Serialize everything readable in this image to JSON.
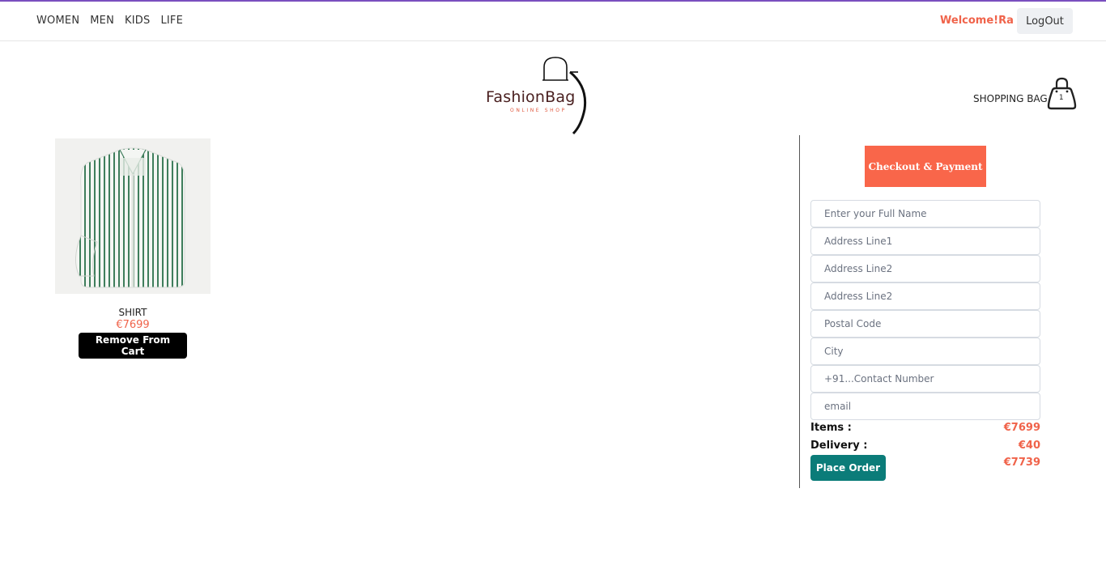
{
  "nav": {
    "links": [
      "WOMEN",
      "MEN",
      "KIDS",
      "LIFE"
    ],
    "welcome": "Welcome!Ra",
    "logout": "LogOut"
  },
  "logo": {
    "name": "FashionBag",
    "tagline": "ONLINE SHOP"
  },
  "bag": {
    "label": "SHOPPING BAG",
    "count": "1"
  },
  "product": {
    "name": "SHIRT",
    "price": "€7699",
    "remove_label": "Remove From Cart"
  },
  "checkout": {
    "title": "Checkout & Payment",
    "fields": {
      "full_name": "Enter your Full Name",
      "address1": "Address Line1",
      "address2": "Address Line2",
      "address3": "Address Line2",
      "postal": "Postal Code",
      "city": "City",
      "contact": "+91...Contact Number",
      "email": "email"
    },
    "items_label": "Items :",
    "items_value": "€7699",
    "delivery_label": "Delivery :",
    "delivery_value": "€40",
    "total_value": "€7739",
    "place_order": "Place Order"
  },
  "colors": {
    "accent": "#f0634a",
    "checkout_header": "#f9664a",
    "place_order": "#0b7c79",
    "top_border": "#7a4fbf"
  }
}
